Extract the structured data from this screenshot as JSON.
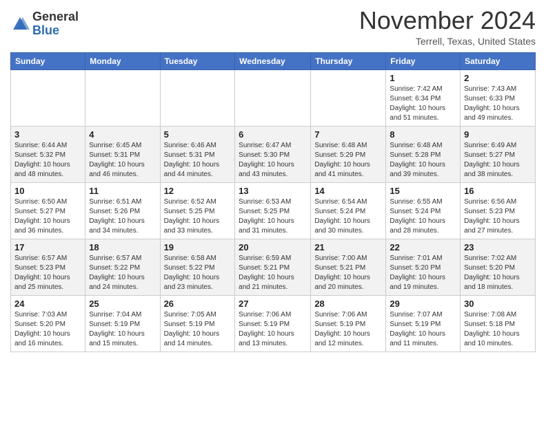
{
  "header": {
    "logo_general": "General",
    "logo_blue": "Blue",
    "month_title": "November 2024",
    "location": "Terrell, Texas, United States"
  },
  "days_of_week": [
    "Sunday",
    "Monday",
    "Tuesday",
    "Wednesday",
    "Thursday",
    "Friday",
    "Saturday"
  ],
  "weeks": [
    [
      {
        "day": "",
        "info": ""
      },
      {
        "day": "",
        "info": ""
      },
      {
        "day": "",
        "info": ""
      },
      {
        "day": "",
        "info": ""
      },
      {
        "day": "",
        "info": ""
      },
      {
        "day": "1",
        "info": "Sunrise: 7:42 AM\nSunset: 6:34 PM\nDaylight: 10 hours and 51 minutes."
      },
      {
        "day": "2",
        "info": "Sunrise: 7:43 AM\nSunset: 6:33 PM\nDaylight: 10 hours and 49 minutes."
      }
    ],
    [
      {
        "day": "3",
        "info": "Sunrise: 6:44 AM\nSunset: 5:32 PM\nDaylight: 10 hours and 48 minutes."
      },
      {
        "day": "4",
        "info": "Sunrise: 6:45 AM\nSunset: 5:31 PM\nDaylight: 10 hours and 46 minutes."
      },
      {
        "day": "5",
        "info": "Sunrise: 6:46 AM\nSunset: 5:31 PM\nDaylight: 10 hours and 44 minutes."
      },
      {
        "day": "6",
        "info": "Sunrise: 6:47 AM\nSunset: 5:30 PM\nDaylight: 10 hours and 43 minutes."
      },
      {
        "day": "7",
        "info": "Sunrise: 6:48 AM\nSunset: 5:29 PM\nDaylight: 10 hours and 41 minutes."
      },
      {
        "day": "8",
        "info": "Sunrise: 6:48 AM\nSunset: 5:28 PM\nDaylight: 10 hours and 39 minutes."
      },
      {
        "day": "9",
        "info": "Sunrise: 6:49 AM\nSunset: 5:27 PM\nDaylight: 10 hours and 38 minutes."
      }
    ],
    [
      {
        "day": "10",
        "info": "Sunrise: 6:50 AM\nSunset: 5:27 PM\nDaylight: 10 hours and 36 minutes."
      },
      {
        "day": "11",
        "info": "Sunrise: 6:51 AM\nSunset: 5:26 PM\nDaylight: 10 hours and 34 minutes."
      },
      {
        "day": "12",
        "info": "Sunrise: 6:52 AM\nSunset: 5:25 PM\nDaylight: 10 hours and 33 minutes."
      },
      {
        "day": "13",
        "info": "Sunrise: 6:53 AM\nSunset: 5:25 PM\nDaylight: 10 hours and 31 minutes."
      },
      {
        "day": "14",
        "info": "Sunrise: 6:54 AM\nSunset: 5:24 PM\nDaylight: 10 hours and 30 minutes."
      },
      {
        "day": "15",
        "info": "Sunrise: 6:55 AM\nSunset: 5:24 PM\nDaylight: 10 hours and 28 minutes."
      },
      {
        "day": "16",
        "info": "Sunrise: 6:56 AM\nSunset: 5:23 PM\nDaylight: 10 hours and 27 minutes."
      }
    ],
    [
      {
        "day": "17",
        "info": "Sunrise: 6:57 AM\nSunset: 5:23 PM\nDaylight: 10 hours and 25 minutes."
      },
      {
        "day": "18",
        "info": "Sunrise: 6:57 AM\nSunset: 5:22 PM\nDaylight: 10 hours and 24 minutes."
      },
      {
        "day": "19",
        "info": "Sunrise: 6:58 AM\nSunset: 5:22 PM\nDaylight: 10 hours and 23 minutes."
      },
      {
        "day": "20",
        "info": "Sunrise: 6:59 AM\nSunset: 5:21 PM\nDaylight: 10 hours and 21 minutes."
      },
      {
        "day": "21",
        "info": "Sunrise: 7:00 AM\nSunset: 5:21 PM\nDaylight: 10 hours and 20 minutes."
      },
      {
        "day": "22",
        "info": "Sunrise: 7:01 AM\nSunset: 5:20 PM\nDaylight: 10 hours and 19 minutes."
      },
      {
        "day": "23",
        "info": "Sunrise: 7:02 AM\nSunset: 5:20 PM\nDaylight: 10 hours and 18 minutes."
      }
    ],
    [
      {
        "day": "24",
        "info": "Sunrise: 7:03 AM\nSunset: 5:20 PM\nDaylight: 10 hours and 16 minutes."
      },
      {
        "day": "25",
        "info": "Sunrise: 7:04 AM\nSunset: 5:19 PM\nDaylight: 10 hours and 15 minutes."
      },
      {
        "day": "26",
        "info": "Sunrise: 7:05 AM\nSunset: 5:19 PM\nDaylight: 10 hours and 14 minutes."
      },
      {
        "day": "27",
        "info": "Sunrise: 7:06 AM\nSunset: 5:19 PM\nDaylight: 10 hours and 13 minutes."
      },
      {
        "day": "28",
        "info": "Sunrise: 7:06 AM\nSunset: 5:19 PM\nDaylight: 10 hours and 12 minutes."
      },
      {
        "day": "29",
        "info": "Sunrise: 7:07 AM\nSunset: 5:19 PM\nDaylight: 10 hours and 11 minutes."
      },
      {
        "day": "30",
        "info": "Sunrise: 7:08 AM\nSunset: 5:18 PM\nDaylight: 10 hours and 10 minutes."
      }
    ]
  ]
}
